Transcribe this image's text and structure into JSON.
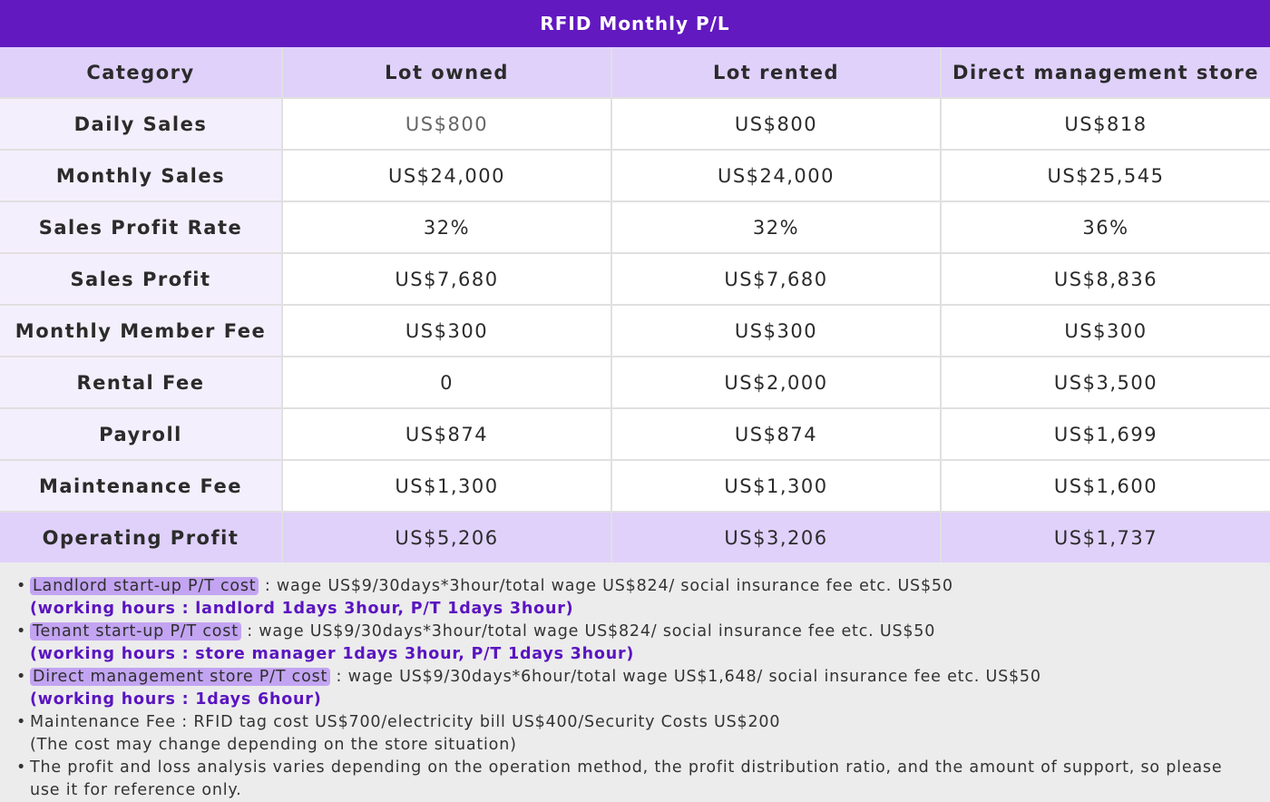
{
  "title": "RFID Monthly P/L",
  "table": {
    "headers": [
      "Category",
      "Lot owned",
      "Lot rented",
      "Direct management store"
    ],
    "rows": [
      {
        "label": "Daily Sales",
        "values": [
          "US$800",
          "US$800",
          "US$818"
        ]
      },
      {
        "label": "Monthly Sales",
        "values": [
          "US$24,000",
          "US$24,000",
          "US$25,545"
        ]
      },
      {
        "label": "Sales Profit Rate",
        "values": [
          "32%",
          "32%",
          "36%"
        ]
      },
      {
        "label": "Sales Profit",
        "values": [
          "US$7,680",
          "US$7,680",
          "US$8,836"
        ]
      },
      {
        "label": "Monthly Member Fee",
        "values": [
          "US$300",
          "US$300",
          "US$300"
        ]
      },
      {
        "label": "Rental Fee",
        "values": [
          "0",
          "US$2,000",
          "US$3,500"
        ]
      },
      {
        "label": "Payroll",
        "values": [
          "US$874",
          "US$874",
          "US$1,699"
        ]
      },
      {
        "label": "Maintenance Fee",
        "values": [
          "US$1,300",
          "US$1,300",
          "US$1,600"
        ]
      },
      {
        "label": "Operating Profit",
        "values": [
          "US$5,206",
          "US$3,206",
          "US$1,737"
        ]
      }
    ]
  },
  "notes": {
    "bullet": "•",
    "landlord": {
      "tag": "Landlord start-up P/T cost",
      "text": " : wage US$9/30days*3hour/total wage US$824/ social insurance fee etc. US$50",
      "hours": "(working hours : landlord 1days 3hour, P/T 1days 3hour)"
    },
    "tenant": {
      "tag": "Tenant start-up P/T cost",
      "text": " : wage US$9/30days*3hour/total wage US$824/ social insurance fee etc. US$50",
      "hours": "(working hours : store manager 1days 3hour, P/T 1days 3hour)"
    },
    "direct": {
      "tag": "Direct management store P/T cost",
      "text": " : wage US$9/30days*6hour/total wage US$1,648/ social insurance fee etc. US$50",
      "hours": "(working hours : 1days 6hour)"
    },
    "maintenance": {
      "text": "Maintenance Fee : RFID tag cost  US$700/electricity bill US$400/Security Costs US$200",
      "sub": "(The cost may change depending on the store situation)"
    },
    "disclaimer": "The profit and loss analysis varies depending on the operation method, the profit distribution ratio, and the amount of support, so please use it for reference only."
  }
}
